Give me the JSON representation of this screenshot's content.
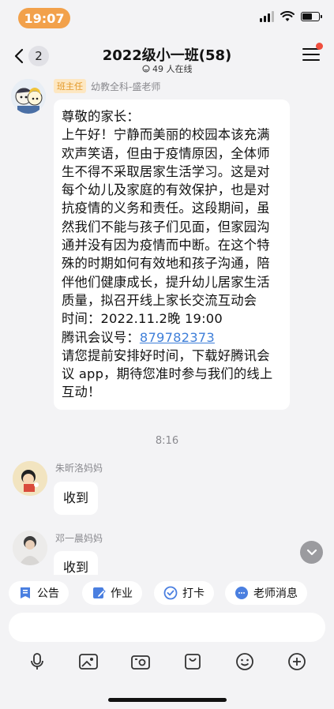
{
  "status": {
    "time": "19:07",
    "battery_level": 0.6
  },
  "nav": {
    "back_count": "2",
    "title": "2022级小一班(58)",
    "online": "49 人在线"
  },
  "messages": [
    {
      "role_tag": "班主任",
      "sender": "幼教全科-盛老师",
      "lines": [
        "尊敬的家长：",
        "上午好！宁静而美丽的校园本该充满欢声笑语，但由于疫情原因，全体师生不得不采取居家生活学习。这是对每个幼儿及家庭的有效保护，也是对抗疫情的义务和责任。这段期间，虽然我们不能与孩子们见面，但家园沟通并没有因为疫情而中断。在这个特殊的时期如何有效地和孩子沟通，陪伴他们健康成长，提升幼儿居家生活质量，拟召开线上家长交流互动会",
        "时间：2022.11.2晚 19:00"
      ],
      "meeting_label": "腾讯会议号：",
      "meeting_id": "879782373",
      "closing": "请您提前安排好时间，下载好腾讯会议 app，期待您准时参与我们的线上互动！"
    },
    {
      "sender": "朱昕洛妈妈",
      "text": "收到"
    },
    {
      "sender": "邓一晨妈妈",
      "text": "收到"
    }
  ],
  "timestamp": "8:16",
  "shortcuts": [
    {
      "label": "公告",
      "icon": "announcement-icon"
    },
    {
      "label": "作业",
      "icon": "homework-icon"
    },
    {
      "label": "打卡",
      "icon": "checkin-icon"
    },
    {
      "label": "老师消息",
      "icon": "teacher-message-icon"
    }
  ],
  "toolbar_icons": [
    "microphone-icon",
    "image-icon",
    "camera-icon",
    "bag-icon",
    "emoji-icon",
    "plus-icon"
  ],
  "colors": {
    "accent": "#3f7fd9",
    "time_pill": "#f2a14b",
    "role_tag_bg": "#fde7c2",
    "role_tag_text": "#e39a2b",
    "notification_dot": "#f04e3e"
  }
}
